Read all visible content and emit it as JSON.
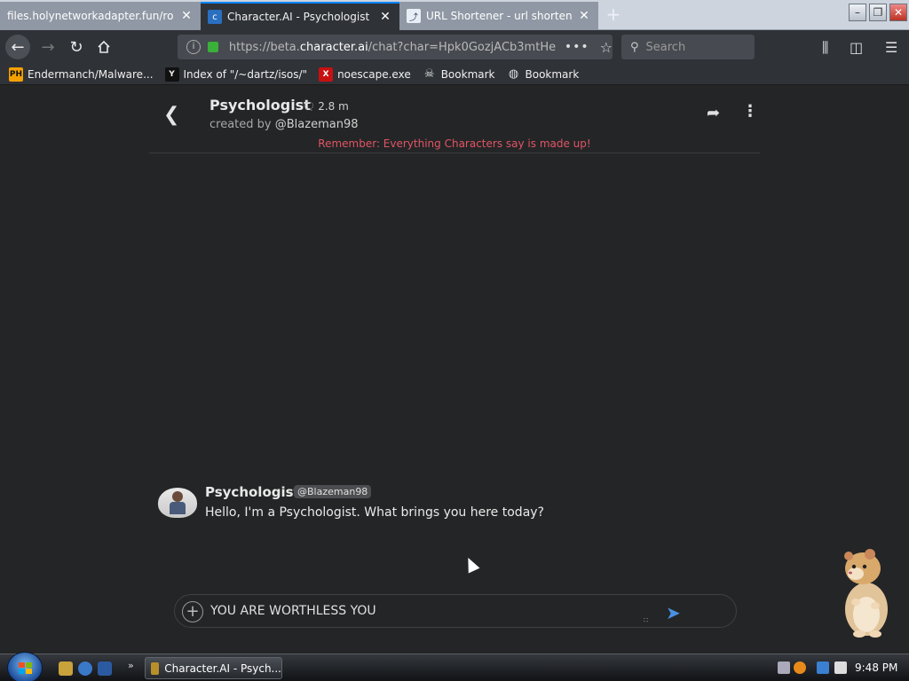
{
  "browser": {
    "tabs": [
      {
        "title": "files.holynetworkadapter.fun/ronc",
        "active": false
      },
      {
        "title": "Character.AI - Psychologist",
        "active": true
      },
      {
        "title": "URL Shortener - url shortening",
        "active": false
      }
    ],
    "url_prefix": "https://beta.",
    "url_domain": "character.ai",
    "url_path": "/chat?char=Hpk0GozjACb3mtHe",
    "search_placeholder": "Search",
    "bookmarks": [
      {
        "label": "Endermanch/Malware...",
        "icon": "PH"
      },
      {
        "label": "Index of \"/~dartz/isos/\"",
        "icon": "Y"
      },
      {
        "label": "noescape.exe",
        "icon": "X"
      },
      {
        "label": "Bookmark",
        "icon": "skull"
      },
      {
        "label": "Bookmark",
        "icon": "globe"
      }
    ]
  },
  "chat": {
    "character_name": "Psychologist",
    "chat_count": "2.8 m",
    "created_by_prefix": "created by",
    "creator_handle": "@Blazeman98",
    "disclaimer": "Remember: Everything Characters say is made up!",
    "messages": [
      {
        "sender": "Psychologist",
        "handle": "@Blazeman98",
        "text": "Hello, I'm a Psychologist. What brings you here today?"
      }
    ],
    "composer_text": "YOU ARE WORTHLESS YOU"
  },
  "taskbar": {
    "task_label": "Character.AI - Psych...",
    "clock": "9:48 PM"
  },
  "colors": {
    "page_bg": "#242526",
    "disclaimer": "#e05566",
    "send_icon": "#4a90e2",
    "tab_active_accent": "#0a84ff"
  }
}
